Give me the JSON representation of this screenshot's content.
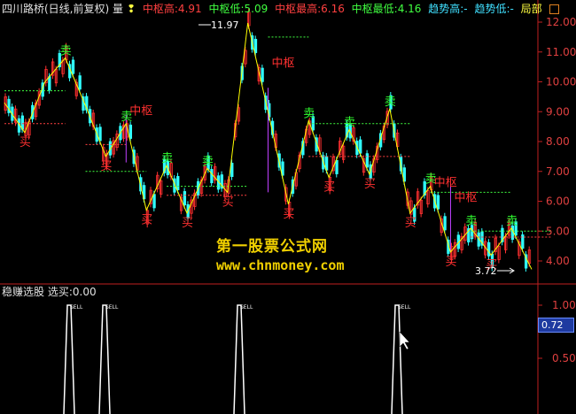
{
  "header": {
    "stock": "四川路桥(日线,前复权) 量",
    "tag": "❢",
    "zs_high": "中枢高:4.91",
    "zs_low": "中枢低:5.09",
    "zs_max": "中枢最高:6.16",
    "zs_min": "中枢最低:4.16",
    "trend_high": "趋势高:-",
    "trend_low": "趋势低:-",
    "local": "局部"
  },
  "sub_header": {
    "name": "稳赚选股",
    "value": "选买:0.00"
  },
  "watermark": {
    "line1": "第一股票公式网",
    "line2": "www.chnmoney.com"
  },
  "price_axis": [
    "12.00",
    "11.00",
    "10.00",
    "9.00",
    "8.00",
    "7.00",
    "6.00",
    "5.00",
    "4.00"
  ],
  "sub_axis": [
    "1.00",
    "0.50"
  ],
  "cursor_value": "0.72",
  "annotations": {
    "peak": "11.97",
    "trough": "3.72",
    "buy": "买",
    "sell": "卖",
    "zs": "中枢",
    "signal": "SELL"
  },
  "colors": {
    "background": "#000000",
    "axis": "#c02020",
    "up": "#ff3030",
    "down": "#30ffff",
    "zigzag": "#ffff00",
    "zs_box": "#c040ff",
    "buy": "#ff3030",
    "sell": "#30ff30"
  },
  "chart_data": {
    "type": "line",
    "x": [
      1,
      2,
      3,
      4,
      5,
      6,
      7,
      8,
      9,
      10,
      11,
      12,
      13,
      14,
      15,
      16,
      17,
      18,
      19,
      20,
      21,
      22,
      23,
      24,
      25,
      26,
      27
    ],
    "values": [
      9.3,
      8.3,
      10.0,
      10.8,
      9.2,
      7.5,
      8.6,
      5.7,
      7.2,
      5.6,
      7.1,
      6.3,
      11.97,
      9.0,
      5.9,
      8.7,
      6.8,
      8.4,
      6.9,
      9.1,
      5.6,
      6.5,
      4.3,
      5.1,
      4.2,
      5.1,
      3.72
    ],
    "ylim": [
      3.5,
      12.3
    ],
    "sub_signals": [
      {
        "x": 78,
        "value": 1.0
      },
      {
        "x": 118,
        "value": 1.0
      },
      {
        "x": 270,
        "value": 1.0
      },
      {
        "x": 448,
        "value": 1.0
      }
    ],
    "grid": false
  }
}
